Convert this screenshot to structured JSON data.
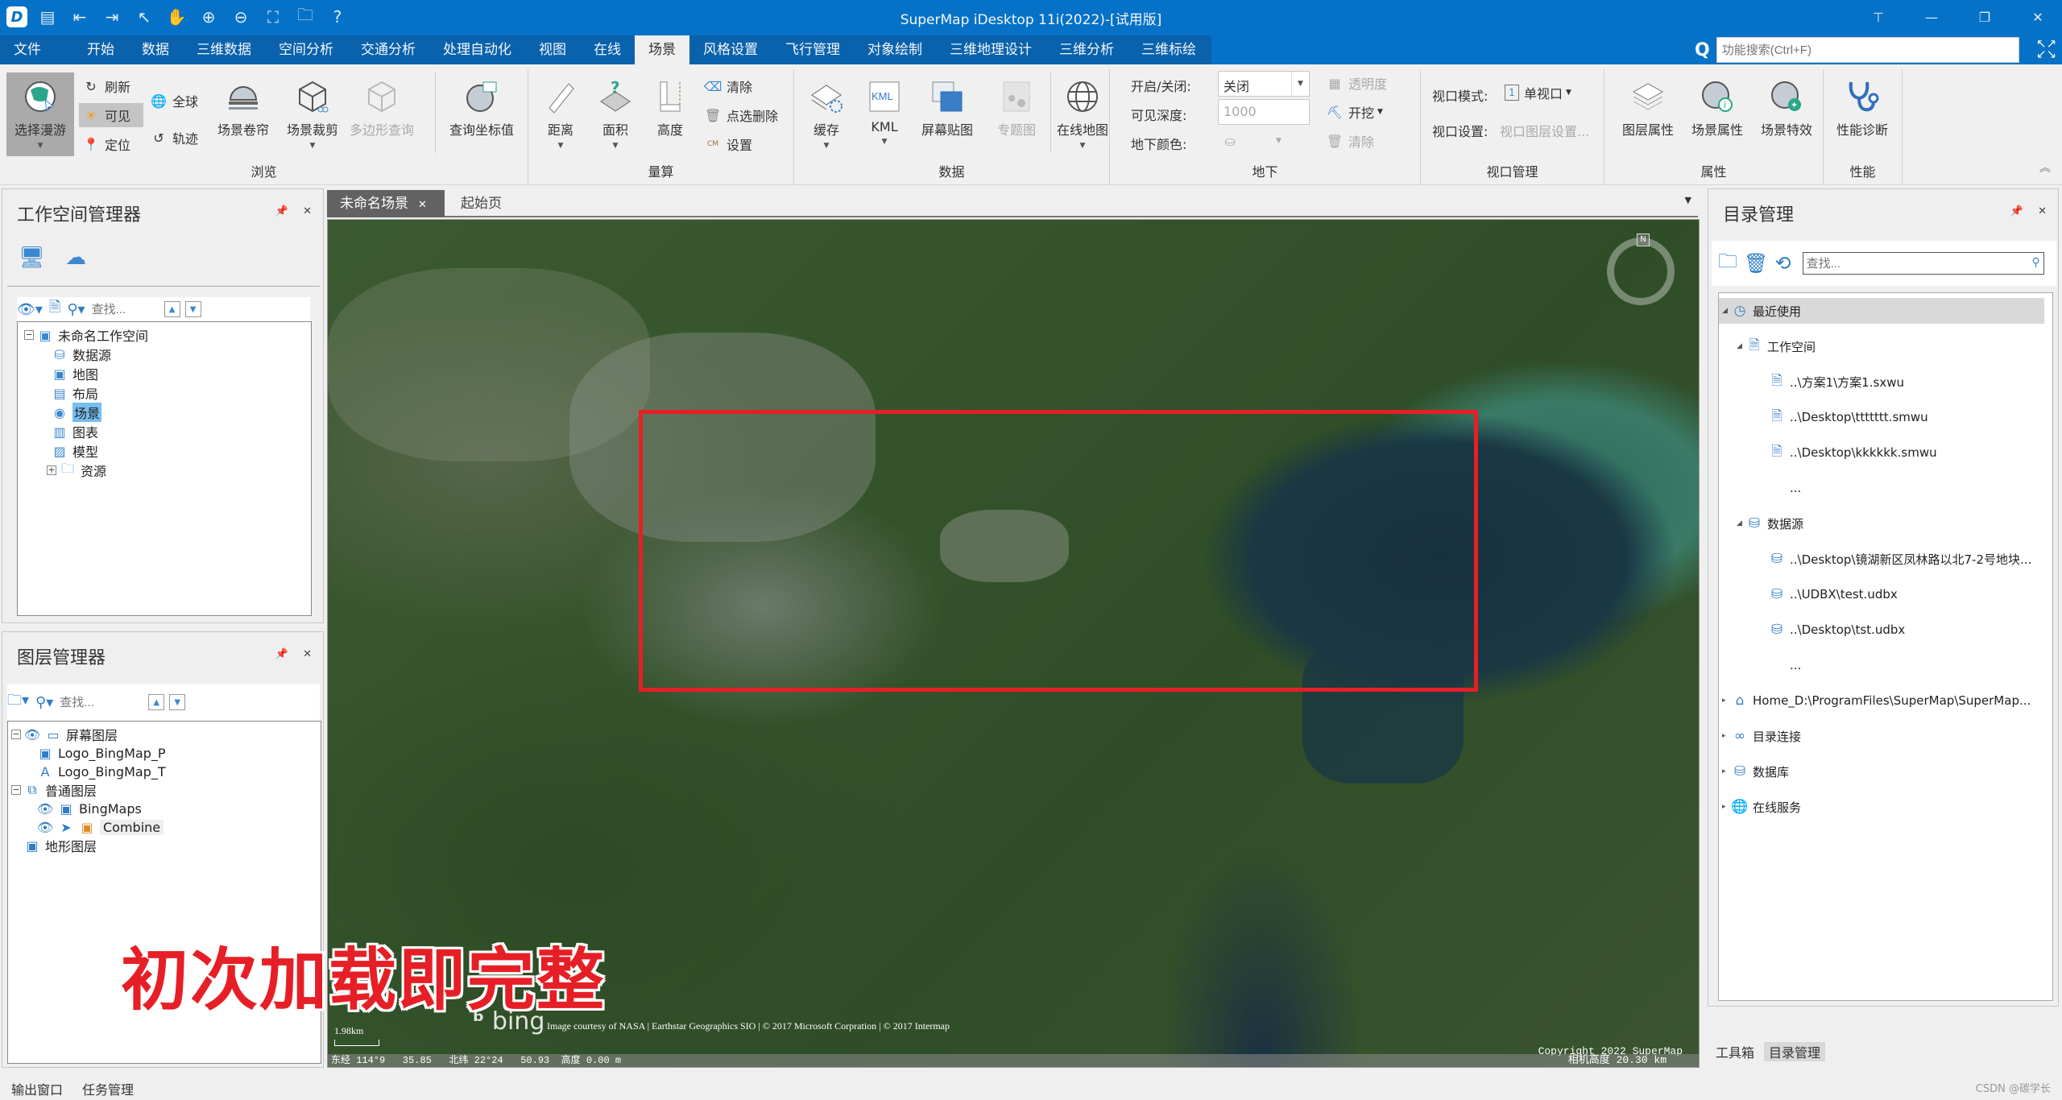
{
  "window": {
    "title": "SuperMap iDesktop 11i(2022)-[试用版]",
    "quick_access": [
      "app-logo",
      "save",
      "import",
      "export",
      "select",
      "pan",
      "zoom-in",
      "zoom-out",
      "full-extent",
      "open",
      "help"
    ]
  },
  "menu": {
    "tabs": [
      "文件",
      "开始",
      "数据",
      "三维数据",
      "空间分析",
      "交通分析",
      "处理自动化",
      "视图",
      "在线",
      "场景",
      "风格设置",
      "飞行管理",
      "对象绘制",
      "三维地理设计",
      "三维分析",
      "三维标绘"
    ],
    "active_tab": "场景",
    "search_placeholder": "功能搜索(Ctrl+F)"
  },
  "ribbon": {
    "browse": {
      "label": "浏览",
      "select_roam": "选择漫游",
      "refresh": "刷新",
      "visible": "可见",
      "locate": "定位",
      "globe": "全球",
      "track": "轨迹",
      "scene_swipe": "场景卷帘",
      "scene_clip": "场景裁剪",
      "polygon_query": "多边形查询",
      "query_coord": "查询坐标值"
    },
    "measure": {
      "label": "量算",
      "distance": "距离",
      "area": "面积",
      "height": "高度",
      "clear": "清除",
      "pick_delete": "点选删除",
      "settings": "设置"
    },
    "data": {
      "label": "数据",
      "cache": "缓存",
      "kml": "KML",
      "screen_map": "屏幕贴图",
      "thematic": "专题图",
      "online_map": "在线地图"
    },
    "underground": {
      "label": "地下",
      "onoff_label": "开启/关闭:",
      "onoff_value": "关闭",
      "depth_label": "可见深度:",
      "depth_value": "1000",
      "color_label": "地下颜色:",
      "transparency": "透明度",
      "excavate": "开挖",
      "clear": "清除"
    },
    "viewport": {
      "label": "视口管理",
      "mode_label": "视口模式:",
      "mode_value": "单视口",
      "settings_label": "视口设置:",
      "settings_value": "视口图层设置..."
    },
    "properties": {
      "label": "属性",
      "layer_props": "图层属性",
      "scene_props": "场景属性",
      "scene_effects": "场景特效"
    },
    "performance": {
      "label": "性能",
      "diagnose": "性能诊断"
    }
  },
  "workspace_manager": {
    "title": "工作空间管理器",
    "search_placeholder": "查找...",
    "root": "未命名工作空间",
    "items": [
      "数据源",
      "地图",
      "布局",
      "场景",
      "图表",
      "模型",
      "资源"
    ],
    "selected": "场景"
  },
  "layer_manager": {
    "title": "图层管理器",
    "search_placeholder": "查找...",
    "groups": [
      {
        "name": "屏幕图层",
        "children": [
          "Logo_BingMap_P",
          "Logo_BingMap_T"
        ]
      },
      {
        "name": "普通图层",
        "children": [
          "BingMaps",
          "Combine"
        ]
      },
      {
        "name": "地形图层",
        "children": []
      }
    ]
  },
  "doc_tabs": {
    "active": "未命名场景",
    "other": "起始页"
  },
  "map": {
    "overlay_caption": "初次加载即完整",
    "highlight_color": "#e61f26",
    "compass_label": "N",
    "scale": "1.98km",
    "attribution": "Image courtesy of NASA | Earthstar Geographics SIO | © 2017 Microsoft Corpration | © 2017 Intermap",
    "bing": "bing",
    "status": "东经 114°9   35.85   北纬 22°24   50.93  高度 0.00 m",
    "copyright": "Copyright 2022 SuperMap",
    "camera_alt": "相机高度 20.30 km"
  },
  "catalog": {
    "title": "目录管理",
    "search_placeholder": "查找...",
    "recent": "最近使用",
    "workspace_group": "工作空间",
    "workspaces": [
      "..\\方案1\\方案1.sxwu",
      "..\\Desktop\\ttttttt.smwu",
      "..\\Desktop\\kkkkkk.smwu",
      "..."
    ],
    "datasource_group": "数据源",
    "datasources": [
      "..\\Desktop\\镜湖新区凤林路以北7-2号地块...",
      "..\\UDBX\\test.udbx",
      "..\\Desktop\\tst.udbx",
      "..."
    ],
    "home": "Home_D:\\ProgramFiles\\SuperMap\\SuperMap...",
    "dir_connect": "目录连接",
    "database": "数据库",
    "online_service": "在线服务"
  },
  "bottom": {
    "left_tabs": [
      "输出窗口",
      "任务管理"
    ],
    "right_tabs": [
      "工具箱",
      "目录管理"
    ],
    "watermark": "CSDN @碳学长"
  }
}
